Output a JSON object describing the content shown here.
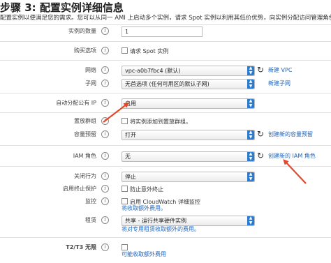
{
  "header": {
    "title": "步骤 3: 配置实例详细信息",
    "subtitle": "配置实例以便满足您的需求。您可以从同一 AMI 上启动多个实例，请求 Spot 实例以利用其低价优势，向实例分配访问管理角色等等。"
  },
  "fields": {
    "instance_count": {
      "label": "实例的数量",
      "value": "1"
    },
    "purchase": {
      "label": "购买选项",
      "checkbox_label": "请求 Spot 实例"
    },
    "network": {
      "label": "网络",
      "value": "vpc-a0b7fbc4 (默认)",
      "link": "新建 VPC"
    },
    "subnet": {
      "label": "子网",
      "value": "无首选项 (任何可用区的默认子网)",
      "link": "新建子网"
    },
    "auto_ip": {
      "label": "自动分配公有 IP",
      "value": "启用"
    },
    "placement": {
      "label": "置放群组",
      "checkbox_label": "将实例添加到置放群组。"
    },
    "capacity": {
      "label": "容量预留",
      "value": "打开",
      "link": "创建新的容量预留"
    },
    "iam": {
      "label": "IAM 角色",
      "value": "无",
      "link": "创建新的 IAM 角色"
    },
    "shutdown": {
      "label": "关闭行为",
      "value": "停止"
    },
    "termination": {
      "label": "启用终止保护",
      "checkbox_label": "防止意外终止"
    },
    "monitoring": {
      "label": "监控",
      "checkbox_label": "启用 CloudWatch 详细监控",
      "note": "将收取额外费用。"
    },
    "tenancy": {
      "label": "租赁",
      "value": "共享 - 运行共享硬件实例",
      "note": "将对专用租赁收取额外的费用。"
    },
    "t2t3": {
      "label": "T2/T3 无限",
      "checkbox_label": "",
      "note": "可能收取额外费用"
    }
  },
  "icons": {
    "info": "info-icon",
    "refresh": "refresh-icon",
    "caret": "caret-icon",
    "annotation_arrow": "red-arrow"
  },
  "colors": {
    "link": "#1b64c0",
    "annotation": "#e0492b",
    "caret": "#2a7ad0"
  }
}
